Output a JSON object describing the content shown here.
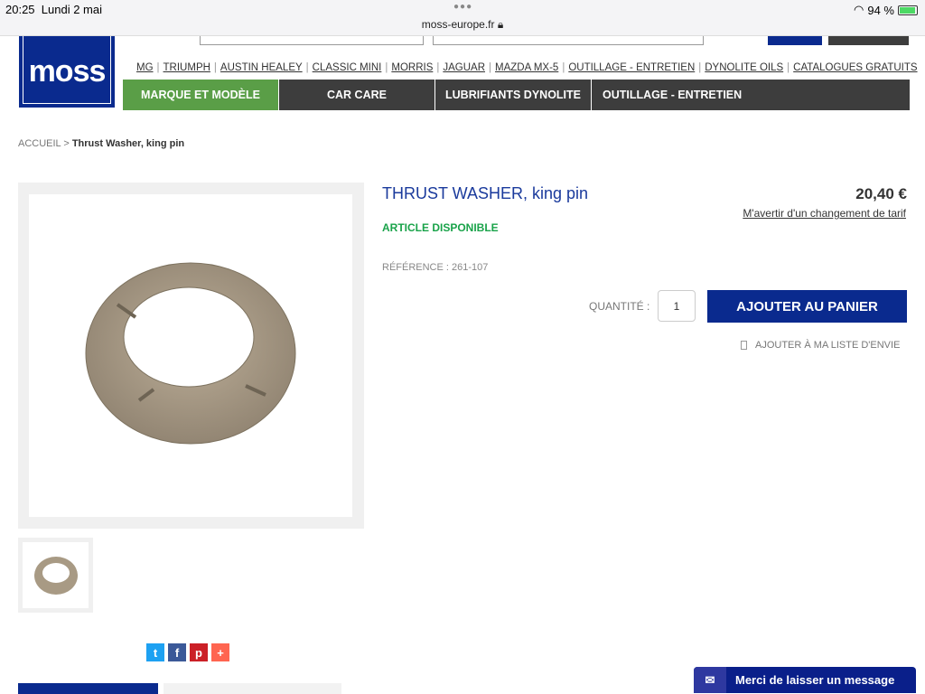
{
  "statusbar": {
    "time": "20:25",
    "date": "Lundi 2 mai",
    "url": "moss-europe.fr",
    "battery": "94 %"
  },
  "logo": "MOSS",
  "toplinks": [
    "MG",
    "TRIUMPH",
    "AUSTIN HEALEY",
    "CLASSIC MINI",
    "MORRIS",
    "JAGUAR",
    "MAZDA MX-5",
    "OUTILLAGE - ENTRETIEN",
    "DYNOLITE OILS",
    "CATALOGUES GRATUITS"
  ],
  "nav": [
    {
      "label": "MARQUE ET MODÈLE",
      "color": "#5a9e47"
    },
    {
      "label": "CAR CARE"
    },
    {
      "label": "LUBRIFIANTS DYNOLITE"
    },
    {
      "label": "OUTILLAGE - ENTRETIEN"
    }
  ],
  "breadcrumb": {
    "home": "ACCUEIL",
    "sep": " > ",
    "current": "Thrust Washer, king pin"
  },
  "product": {
    "title": "THRUST WASHER, king pin",
    "price": "20,40 €",
    "notify": "M'avertir d'un changement de tarif",
    "availability": "ARTICLE DISPONIBLE",
    "reference": "RÉFÉRENCE : 261-107",
    "qty_label": "QUANTITÉ :",
    "qty": "1",
    "add_to_cart": "AJOUTER AU PANIER",
    "wishlist": "AJOUTER À MA LISTE D'ENVIE"
  },
  "social": [
    {
      "icon": "twitter-icon",
      "glyph": "t",
      "color": "#1da1f2"
    },
    {
      "icon": "facebook-icon",
      "glyph": "f",
      "color": "#3b5998"
    },
    {
      "icon": "pinterest-icon",
      "glyph": "p",
      "color": "#cb2027"
    },
    {
      "icon": "plus-icon",
      "glyph": "+",
      "color": "#ff6550"
    }
  ],
  "chat": {
    "label": "Merci de laisser un message"
  },
  "colors": {
    "brand": "#0a2a8e",
    "available": "#1aa34a",
    "nav": "#3d3d3d"
  }
}
